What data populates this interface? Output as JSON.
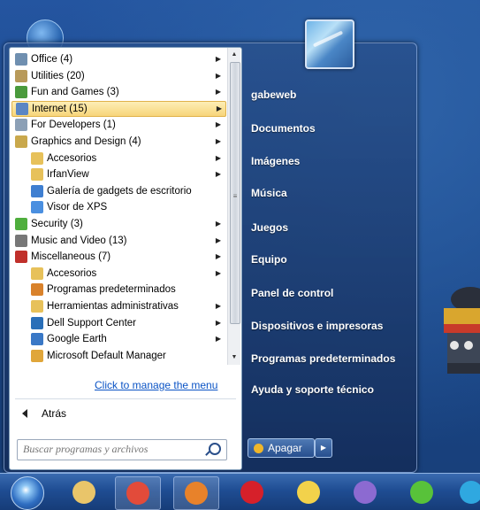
{
  "start_menu": {
    "programs": [
      {
        "label": "Office (4)",
        "icon": "office-folder-icon",
        "color": "#6f8fb0",
        "submenu": true,
        "level": 0
      },
      {
        "label": "Utilities (20)",
        "icon": "utilities-icon",
        "color": "#b89a5a",
        "submenu": true,
        "level": 0
      },
      {
        "label": "Fun and Games (3)",
        "icon": "games-icon",
        "color": "#4a9a3c",
        "submenu": true,
        "level": 0
      },
      {
        "label": "Internet (15)",
        "icon": "internet-icon",
        "color": "#5b86c4",
        "submenu": true,
        "level": 0,
        "selected": true
      },
      {
        "label": "For Developers (1)",
        "icon": "developer-icon",
        "color": "#8ca0b6",
        "submenu": true,
        "level": 0
      },
      {
        "label": "Graphics and Design (4)",
        "icon": "graphics-icon",
        "color": "#c9a84c",
        "submenu": true,
        "level": 0
      },
      {
        "label": "Accesorios",
        "icon": "folder-icon",
        "color": "#e7c15a",
        "submenu": true,
        "level": 1
      },
      {
        "label": "IrfanView",
        "icon": "folder-icon",
        "color": "#e7c15a",
        "submenu": true,
        "level": 1
      },
      {
        "label": "Galería de gadgets de escritorio",
        "icon": "gadgets-icon",
        "color": "#3f7fd1",
        "submenu": false,
        "level": 1
      },
      {
        "label": "Visor de XPS",
        "icon": "xps-icon",
        "color": "#4a8fe0",
        "submenu": false,
        "level": 1
      },
      {
        "label": "Security (3)",
        "icon": "security-shield-icon",
        "color": "#4fae3d",
        "submenu": true,
        "level": 0
      },
      {
        "label": "Music and Video (13)",
        "icon": "music-icon",
        "color": "#777777",
        "submenu": true,
        "level": 0
      },
      {
        "label": "Miscellaneous (7)",
        "icon": "misc-heart-icon",
        "color": "#c0302b",
        "submenu": true,
        "level": 0
      },
      {
        "label": "Accesorios",
        "icon": "folder-icon",
        "color": "#e7c15a",
        "submenu": true,
        "level": 1
      },
      {
        "label": "Programas predeterminados",
        "icon": "default-programs-icon",
        "color": "#d9822b",
        "submenu": false,
        "level": 1
      },
      {
        "label": "Herramientas administrativas",
        "icon": "folder-icon",
        "color": "#e7c15a",
        "submenu": true,
        "level": 1
      },
      {
        "label": "Dell Support Center",
        "icon": "dell-icon",
        "color": "#2a6fb8",
        "submenu": true,
        "level": 1
      },
      {
        "label": "Google Earth",
        "icon": "google-earth-icon",
        "color": "#3a78c6",
        "submenu": true,
        "level": 1
      },
      {
        "label": "Microsoft Default Manager",
        "icon": "ms-manager-icon",
        "color": "#e0a63a",
        "submenu": false,
        "level": 1
      }
    ],
    "manage_link": "Click to manage the menu",
    "back_label": "Atrás",
    "search_placeholder": "Buscar programas y archivos"
  },
  "right_pane": {
    "items": [
      {
        "label": "gabeweb",
        "name": "user-name"
      },
      {
        "label": "Documentos",
        "name": "documents-link"
      },
      {
        "label": "Imágenes",
        "name": "pictures-link"
      },
      {
        "label": "Música",
        "name": "music-link"
      },
      {
        "label": "Juegos",
        "name": "games-link"
      },
      {
        "label": "Equipo",
        "name": "computer-link"
      },
      {
        "label": "Panel de control",
        "name": "control-panel-link"
      },
      {
        "label": "Dispositivos e impresoras",
        "name": "devices-printers-link"
      },
      {
        "label": "Programas predeterminados",
        "name": "default-programs-link"
      },
      {
        "label": "Ayuda y soporte técnico",
        "name": "help-support-link"
      }
    ],
    "shutdown_label": "Apagar"
  },
  "taskbar": {
    "items": [
      {
        "name": "explorer-icon",
        "color": "#e9c56a"
      },
      {
        "name": "chrome-icon",
        "color": "#e24b3a"
      },
      {
        "name": "firefox-icon",
        "color": "#e8822a"
      },
      {
        "name": "opera-icon",
        "color": "#d6202a"
      },
      {
        "name": "app-bird-icon",
        "color": "#f2d24b"
      },
      {
        "name": "pidgin-icon",
        "color": "#8c6ad1"
      },
      {
        "name": "icq-icon",
        "color": "#58c23a"
      },
      {
        "name": "skype-icon",
        "color": "#2fa8e0"
      }
    ]
  }
}
